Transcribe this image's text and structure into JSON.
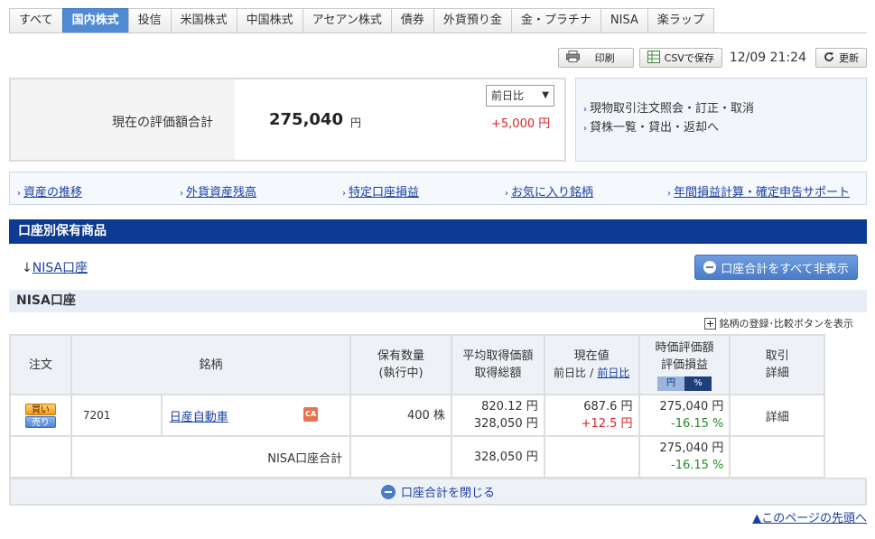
{
  "tabs": [
    "すべて",
    "国内株式",
    "投信",
    "米国株式",
    "中国株式",
    "アセアン株式",
    "債券",
    "外貨預り金",
    "金・プラチナ",
    "NISA",
    "楽ラップ"
  ],
  "active_tab": "国内株式",
  "toolbar": {
    "print_label": "印刷",
    "csv_label": "CSVで保存",
    "timestamp": "12/09 21:24",
    "refresh_label": "更新"
  },
  "summary": {
    "label": "現在の評価額合計",
    "value": "275,040",
    "unit": "円",
    "compare_select": "前日比",
    "change": "+5,000 円"
  },
  "right_links": [
    "現物取引注文照会・訂正・取消",
    "貸株一覧・貸出・返却へ"
  ],
  "quick_links": [
    "資産の推移",
    "外貨資産残高",
    "特定口座損益",
    "お気に入り銘柄",
    "年間損益計算・確定申告サポート"
  ],
  "section_title": "口座別保有商品",
  "nisa_anchor": "NISA口座",
  "hide_all_label": "口座合計をすべて非表示",
  "subheader": "NISA口座",
  "register_toggle": "銘柄の登録･比較ボタンを表示",
  "table": {
    "headers": {
      "order": "注文",
      "issue": "銘柄",
      "qty_1": "保有数量",
      "qty_2": "(執行中)",
      "avg_1": "平均取得価額",
      "avg_2": "取得総額",
      "cur_1": "現在値",
      "cur_2a": "前日比",
      "cur_2b": "前日比",
      "val_1": "時価評価額",
      "val_2": "評価損益",
      "yen_btn": "円",
      "pct_btn": "%",
      "detail_1": "取引",
      "detail_2": "詳細"
    },
    "row": {
      "buy": "買い",
      "sell": "売り",
      "code": "7201",
      "name": "日産自動車",
      "ca_icon": "CA",
      "qty": "400 株",
      "avg_price": "820.12 円",
      "total_cost": "328,050 円",
      "current": "687.6 円",
      "day_change": "+12.5 円",
      "market_value": "275,040 円",
      "pl_pct": "-16.15 %",
      "detail": "詳細"
    },
    "total": {
      "label": "NISA口座合計",
      "total_cost": "328,050 円",
      "market_value": "275,040 円",
      "pl_pct": "-16.15 %"
    }
  },
  "close_label": "口座合計を閉じる",
  "page_top": "▲このページの先頭へ"
}
